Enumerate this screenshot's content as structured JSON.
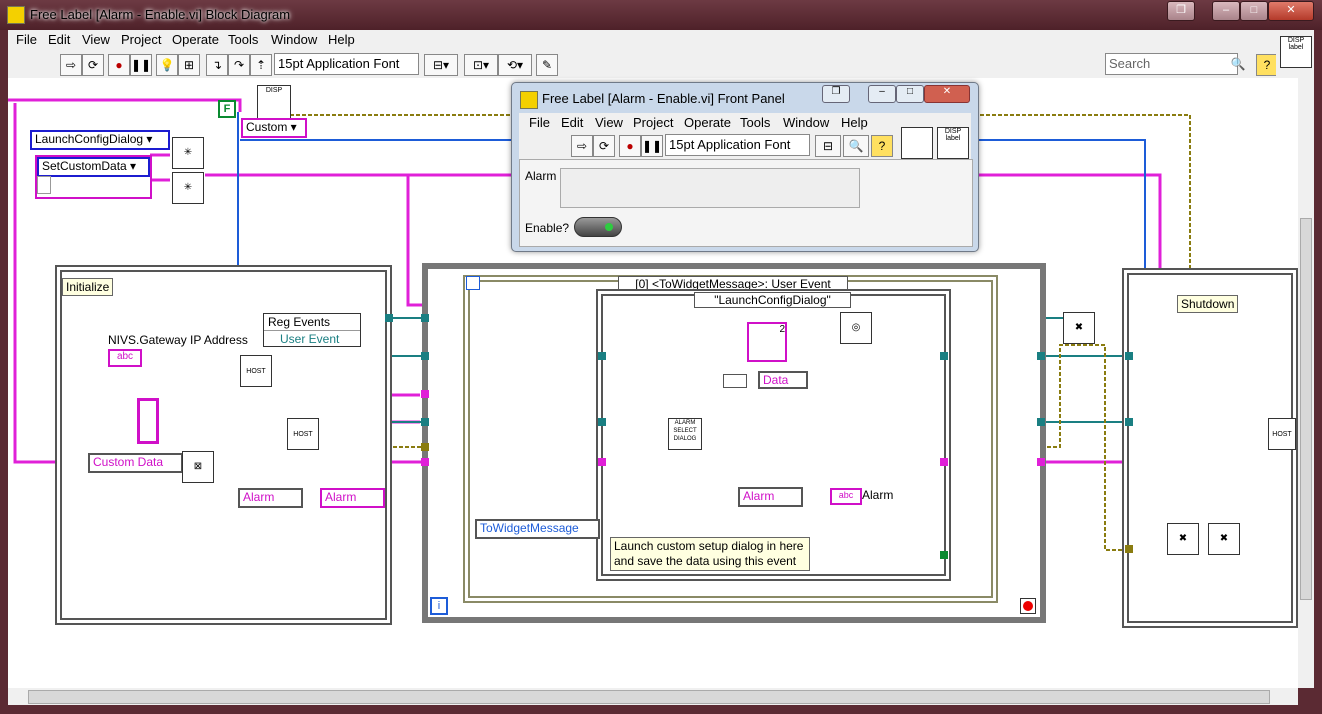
{
  "window": {
    "title": "Free Label [Alarm - Enable.vi] Block Diagram"
  },
  "menu": [
    "File",
    "Edit",
    "View",
    "Project",
    "Operate",
    "Tools",
    "Window",
    "Help"
  ],
  "toolbar": {
    "font": "15pt Application Font",
    "search_placeholder": "Search",
    "help": "?"
  },
  "icons": {
    "disp": "DISP",
    "label": "label",
    "host": "HOST",
    "alarm_select": "ALARM SELECT DIALOG"
  },
  "diagram": {
    "launch_config": "LaunchConfigDialog",
    "set_custom": "SetCustomData",
    "custom": "Custom",
    "false_const": "F",
    "initialize": "Initialize",
    "nivs_label": "NIVS.Gateway IP Address",
    "abc": "abc",
    "reg_events": "Reg Events",
    "user_event": "User Event",
    "custom_data": "Custom Data",
    "alarm1": "Alarm",
    "alarm2": "Alarm",
    "case_selector": "[0] <ToWidgetMessage>: User Event",
    "inner_case": "\"LaunchConfigDialog\"",
    "data": "Data",
    "num_two": "2",
    "alarm3": "Alarm",
    "alarm4": "Alarm",
    "to_widget": "ToWidgetMessage",
    "comment": "Launch custom setup dialog in here and save the data using this event",
    "shutdown": "Shutdown",
    "loop_i": "i"
  },
  "front_panel": {
    "title": "Free Label [Alarm - Enable.vi] Front Panel",
    "menu": [
      "File",
      "Edit",
      "View",
      "Project",
      "Operate",
      "Tools",
      "Window",
      "Help"
    ],
    "font": "15pt Application Font",
    "alarm_label": "Alarm",
    "enable_label": "Enable?"
  },
  "colors": {
    "wire_pink": "#e020d8",
    "wire_blue": "#1d5cd8",
    "wire_teal": "#1a7f82",
    "wire_yellow": "#8a7c10"
  }
}
